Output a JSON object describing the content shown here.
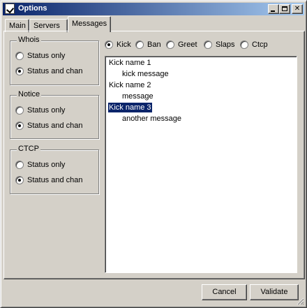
{
  "window": {
    "title": "Options"
  },
  "tabs": [
    {
      "label": "Main"
    },
    {
      "label": "Servers"
    },
    {
      "label": "Messages"
    }
  ],
  "groups": {
    "whois": {
      "label": "Whois",
      "options": [
        "Status only",
        "Status and chan"
      ],
      "selected": "Status and chan"
    },
    "notice": {
      "label": "Notice",
      "options": [
        "Status only",
        "Status and chan"
      ],
      "selected": "Status and chan"
    },
    "ctcp": {
      "label": "CTCP",
      "options": [
        "Status only",
        "Status and chan"
      ],
      "selected": "Status and chan"
    }
  },
  "message_types": {
    "options": [
      "Kick",
      "Ban",
      "Greet",
      "Slaps",
      "Ctcp"
    ],
    "selected": "Kick"
  },
  "messages_list": {
    "items": [
      {
        "text": "Kick name 1"
      },
      {
        "text": "kick message"
      },
      {
        "text": "Kick name 2"
      },
      {
        "text": "message"
      },
      {
        "text": "Kick name 3"
      },
      {
        "text": "another message"
      }
    ]
  },
  "buttons": {
    "cancel": "Cancel",
    "validate": "Validate"
  },
  "colors": {
    "titlebar": "#0a246a",
    "selection": "#0a246a",
    "face": "#d4d0c8"
  }
}
